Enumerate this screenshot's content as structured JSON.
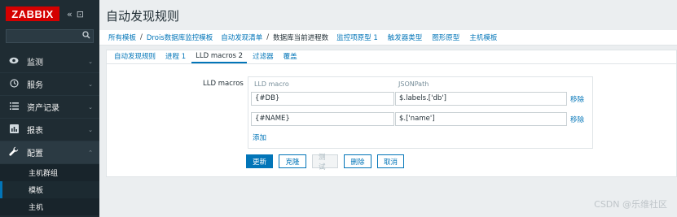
{
  "brand": {
    "logo_text": "ZABBIX",
    "collapse_icon": "«",
    "kiosk_icon": "⊡"
  },
  "search": {
    "placeholder": "",
    "icon": "search-icon"
  },
  "nav": {
    "items": [
      {
        "label": "监测",
        "icon": "eye-icon",
        "chevron": "⌄"
      },
      {
        "label": "服务",
        "icon": "clock-icon",
        "chevron": "⌄"
      },
      {
        "label": "资产记录",
        "icon": "list-icon",
        "chevron": "⌄"
      },
      {
        "label": "报表",
        "icon": "chart-icon",
        "chevron": "⌄"
      },
      {
        "label": "配置",
        "icon": "wrench-icon",
        "chevron": "⌃"
      }
    ],
    "config_sub": [
      {
        "label": "主机群组"
      },
      {
        "label": "模板"
      },
      {
        "label": "主机"
      }
    ]
  },
  "page": {
    "title": "自动发现规则"
  },
  "breadcrumb": {
    "all_templates": "所有模板",
    "template": "Drois数据库监控模板",
    "discovery_list": "自动发现清单",
    "current": "数据库当前进程数",
    "item_prototypes": "监控项原型 1",
    "trigger_types": "触发器类型",
    "graph_prototypes": "图形原型",
    "host_templates": "主机模板"
  },
  "tabs": [
    {
      "label": "自动发现规则"
    },
    {
      "label": "进程 1"
    },
    {
      "label": "LLD macros 2"
    },
    {
      "label": "过滤器"
    },
    {
      "label": "覆盖"
    }
  ],
  "form": {
    "label": "LLD macros",
    "columns": {
      "macro": "LLD macro",
      "path": "JSONPath"
    },
    "rows": [
      {
        "macro": "{#DB}",
        "path": "$.labels.['db']",
        "remove": "移除"
      },
      {
        "macro": "{#NAME}",
        "path": "$.['name']",
        "remove": "移除"
      }
    ],
    "add": "添加"
  },
  "buttons": {
    "update": "更新",
    "clone": "克隆",
    "test": "测试",
    "delete": "删除",
    "cancel": "取消"
  },
  "watermark": "CSDN @乐维社区",
  "colors": {
    "accent": "#0275b8",
    "sidebar": "#1f2c33",
    "logo": "#d40000"
  }
}
